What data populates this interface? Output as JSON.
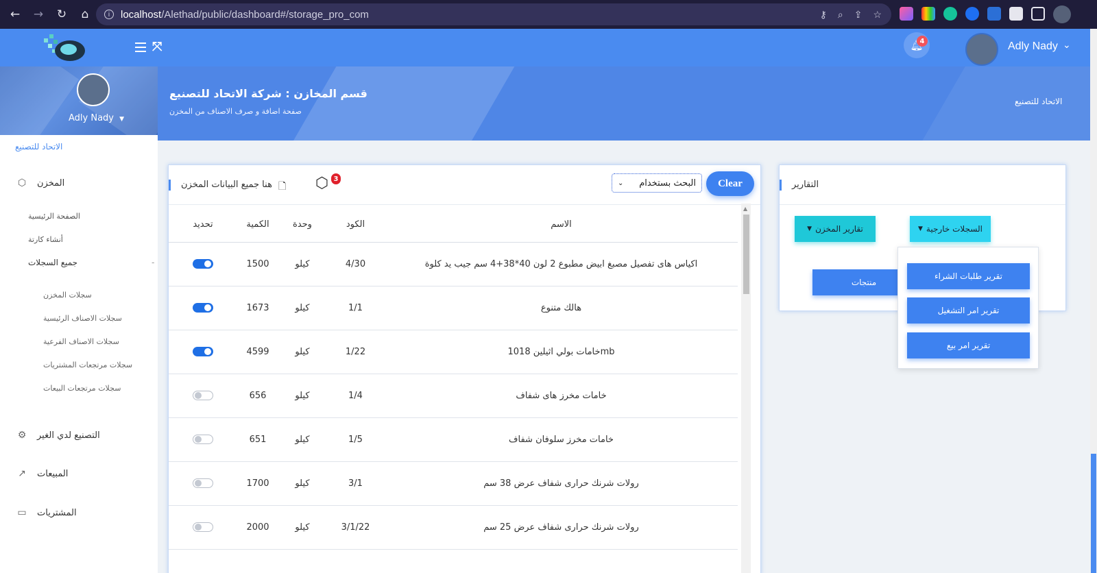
{
  "browser": {
    "url_host": "localhost",
    "url_path": "/Alethad/public/dashboard#/storage_pro_com"
  },
  "topbar": {
    "notification_count": "4",
    "user_name": "Adly Nady"
  },
  "sidebar": {
    "user_name": "Adly Nady",
    "company": "الاتحاد للتصنيع",
    "section_store": "المخزن",
    "sub_home": "الصفحة الرئيسية",
    "sub_items": "أنشاء كارتة",
    "sub_records": "جميع السجلات",
    "records": [
      "سجلات المخزن",
      "سجلات الاصناف الرئيسية",
      "سجلات الاصناف الفرعية",
      "سجلات مرتجعات المشتريات",
      "سجلات مرتجعات البيعات"
    ],
    "section_manufacturing": "التصنيع لدي الغير",
    "section_sales": "المبيعات",
    "section_purchases": "المشتريات"
  },
  "banner": {
    "title": "قسم المخازن : شركة الاتحاد للتصنيع",
    "subtitle": "صفحة اضافة و صرف الاصناف من المخزن",
    "breadcrumb": "الاتحاد للتصنيع"
  },
  "data_card": {
    "title": "هنا جميع البيانات المخزن",
    "box_badge": "3",
    "search_select": "البحث بستخدام",
    "clear_label": "Clear",
    "columns": {
      "toggle": "تحديد",
      "qty": "الكمية",
      "unit": "وحدة",
      "code": "الكود",
      "name": "الاسم"
    },
    "rows": [
      {
        "name": "اكياس هاى تفصيل مصبغ ابيض مطبوع 2 لون 40*38+4 سم جيب يد كلوة",
        "code": "4/30",
        "unit": "كيلو",
        "qty": "1500",
        "on": true
      },
      {
        "name": "هالك متنوع",
        "code": "1/1",
        "unit": "كيلو",
        "qty": "1673",
        "on": true
      },
      {
        "name": "mbخامات بولي اثيلين 1018",
        "code": "1/22",
        "unit": "كيلو",
        "qty": "4599",
        "on": true
      },
      {
        "name": "خامات مخرز هاى شفاف",
        "code": "1/4",
        "unit": "كيلو",
        "qty": "656",
        "on": false
      },
      {
        "name": "خامات مخرز سلوفان شفاف",
        "code": "1/5",
        "unit": "كيلو",
        "qty": "651",
        "on": false
      },
      {
        "name": "رولات شرنك حرارى شفاف عرض 38 سم",
        "code": "3/1",
        "unit": "كيلو",
        "qty": "1700",
        "on": false
      },
      {
        "name": "رولات شرنك حرارى شفاف عرض 25 سم",
        "code": "3/1/22",
        "unit": "كيلو",
        "qty": "2000",
        "on": false
      }
    ]
  },
  "reports_card": {
    "title": "التقارير",
    "external_records_btn": "السجلات خارجية",
    "store_reports_btn": "تقارير المخزن",
    "products_btn": "منتجات",
    "dropdown_items": [
      "تقرير طلبات الشراء",
      "تقرير امر التشغيل",
      "تقرير امر بيع"
    ]
  }
}
